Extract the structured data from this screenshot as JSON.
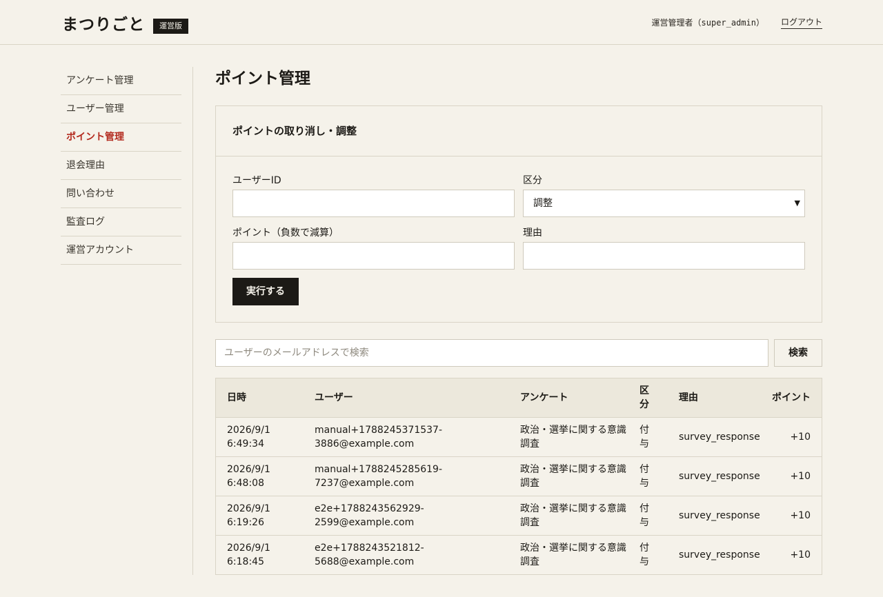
{
  "header": {
    "logo": "まつりごと",
    "badge": "運営版",
    "user_label": "運営管理者（super_admin）",
    "logout": "ログアウト"
  },
  "sidebar": {
    "items": [
      {
        "label": "アンケート管理",
        "active": false
      },
      {
        "label": "ユーザー管理",
        "active": false
      },
      {
        "label": "ポイント管理",
        "active": true
      },
      {
        "label": "退会理由",
        "active": false
      },
      {
        "label": "問い合わせ",
        "active": false
      },
      {
        "label": "監査ログ",
        "active": false
      },
      {
        "label": "運営アカウント",
        "active": false
      }
    ]
  },
  "main": {
    "title": "ポイント管理",
    "form": {
      "title": "ポイントの取り消し・調整",
      "user_id_label": "ユーザーID",
      "user_id_value": "",
      "type_label": "区分",
      "type_value": "調整",
      "points_label": "ポイント（負数で減算）",
      "points_value": "",
      "reason_label": "理由",
      "reason_value": "",
      "submit_label": "実行する"
    },
    "search": {
      "placeholder": "ユーザーのメールアドレスで検索",
      "button_label": "検索"
    },
    "table": {
      "headers": {
        "date": "日時",
        "user": "ユーザー",
        "survey": "アンケート",
        "type": "区分",
        "reason": "理由",
        "points": "ポイント"
      },
      "rows": [
        {
          "date": "2026/9/1 6:49:34",
          "user": "manual+1788245371537-3886@example.com",
          "survey": "政治・選挙に関する意識調査",
          "type": "付与",
          "reason": "survey_response",
          "points": "+10"
        },
        {
          "date": "2026/9/1 6:48:08",
          "user": "manual+1788245285619-7237@example.com",
          "survey": "政治・選挙に関する意識調査",
          "type": "付与",
          "reason": "survey_response",
          "points": "+10"
        },
        {
          "date": "2026/9/1 6:19:26",
          "user": "e2e+1788243562929-2599@example.com",
          "survey": "政治・選挙に関する意識調査",
          "type": "付与",
          "reason": "survey_response",
          "points": "+10"
        },
        {
          "date": "2026/9/1 6:18:45",
          "user": "e2e+1788243521812-5688@example.com",
          "survey": "政治・選挙に関する意識調査",
          "type": "付与",
          "reason": "survey_response",
          "points": "+10"
        }
      ]
    }
  }
}
